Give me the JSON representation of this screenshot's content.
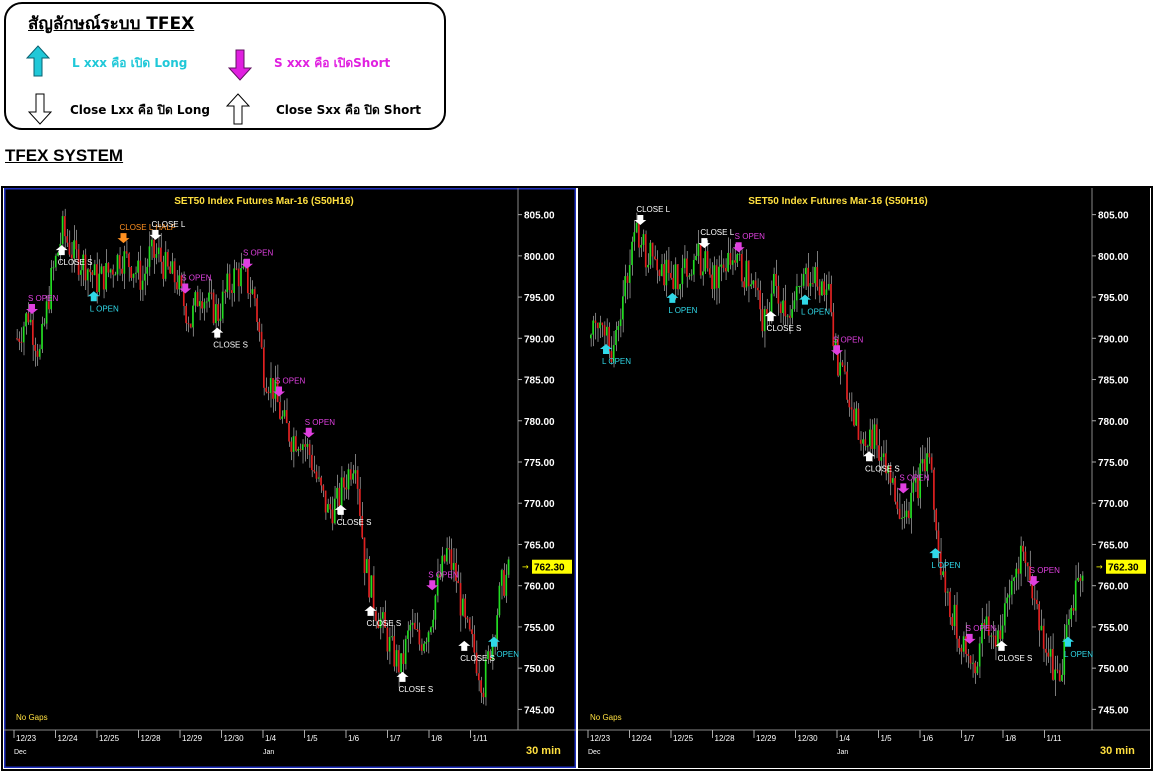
{
  "legend": {
    "title": "สัญลักษณ์ระบบ TFEX",
    "items": [
      {
        "icon": "up-arrow-cyan-icon",
        "label": "L xxx คือ เปิด Long",
        "color": "#20C8D8"
      },
      {
        "icon": "down-arrow-magenta-icon",
        "label": "S xxx คือ เปิดShort",
        "color": "#E020E0"
      },
      {
        "icon": "down-arrow-outline-icon",
        "label": "Close Lxx คือ ปิด Long",
        "color": "#000000"
      },
      {
        "icon": "up-arrow-outline-icon",
        "label": "Close Sxx คือ ปิด Short",
        "color": "#000000"
      }
    ]
  },
  "system_title": "TFEX SYSTEM",
  "chart_data": [
    {
      "type": "candlestick",
      "title": "SET50  Index  Futures  Mar-16   (S50H16)",
      "y_ticks": [
        "805.00",
        "800.00",
        "795.00",
        "790.00",
        "785.00",
        "780.00",
        "775.00",
        "770.00",
        "765.00",
        "760.00",
        "755.00",
        "750.00",
        "745.00"
      ],
      "ylim": [
        742.5,
        807.5
      ],
      "x_ticks": [
        "12/23",
        "12/24",
        "12/25",
        "12/28",
        "12/29",
        "12/30",
        "1/4",
        "1/5",
        "1/6",
        "1/7",
        "1/8",
        "1/11"
      ],
      "month_labels": [
        "Dec",
        "Jan"
      ],
      "last_price": "762.30",
      "interval": "30  min",
      "gap_note": "No Gaps",
      "signals": [
        {
          "label": "S  OPEN",
          "kind": "s-open"
        },
        {
          "label": "CLOSE  S",
          "kind": "close-s"
        },
        {
          "label": "L  OPEN",
          "kind": "l-open"
        },
        {
          "label": "CLOSE  L  HALF",
          "kind": "close-l-half"
        },
        {
          "label": "CLOSE  L",
          "kind": "close-l"
        },
        {
          "label": "S  OPEN",
          "kind": "s-open"
        },
        {
          "label": "CLOSE  S",
          "kind": "close-s"
        },
        {
          "label": "S  OPEN",
          "kind": "s-open"
        },
        {
          "label": "S  OPEN",
          "kind": "s-open"
        },
        {
          "label": "S  OPEN",
          "kind": "s-open"
        },
        {
          "label": "CLOSE  S",
          "kind": "close-s"
        },
        {
          "label": "CLOSE  S",
          "kind": "close-s"
        },
        {
          "label": "CLOSE  S",
          "kind": "close-s"
        },
        {
          "label": "S  OPEN",
          "kind": "s-open"
        },
        {
          "label": "CLOSE  S",
          "kind": "close-s"
        },
        {
          "label": "L  OPEN",
          "kind": "l-open"
        }
      ]
    },
    {
      "type": "candlestick",
      "title": "SET50  Index  Futures  Mar-16   (S50H16)",
      "y_ticks": [
        "805.00",
        "800.00",
        "795.00",
        "790.00",
        "785.00",
        "780.00",
        "775.00",
        "770.00",
        "765.00",
        "760.00",
        "755.00",
        "750.00",
        "745.00"
      ],
      "ylim": [
        742.5,
        807.5
      ],
      "x_ticks": [
        "12/23",
        "12/24",
        "12/25",
        "12/28",
        "12/29",
        "12/30",
        "1/4",
        "1/5",
        "1/6",
        "1/7",
        "1/8",
        "1/11"
      ],
      "month_labels": [
        "Dec",
        "Jan"
      ],
      "last_price": "762.30",
      "interval": "30  min",
      "gap_note": "No Gaps",
      "signals": [
        {
          "label": "L  OPEN",
          "kind": "l-open"
        },
        {
          "label": "CLOSE  L",
          "kind": "close-l"
        },
        {
          "label": "L  OPEN",
          "kind": "l-open"
        },
        {
          "label": "CLOSE  L",
          "kind": "close-l"
        },
        {
          "label": "S  OPEN",
          "kind": "s-open"
        },
        {
          "label": "CLOSE  S",
          "kind": "close-s"
        },
        {
          "label": "L  OPEN",
          "kind": "l-open"
        },
        {
          "label": "S  OPEN",
          "kind": "s-open"
        },
        {
          "label": "CLOSE  S",
          "kind": "close-s"
        },
        {
          "label": "S  OPEN",
          "kind": "s-open"
        },
        {
          "label": "L  OPEN",
          "kind": "l-open"
        },
        {
          "label": "S  OPEN",
          "kind": "s-open"
        },
        {
          "label": "CLOSE  S",
          "kind": "close-s"
        },
        {
          "label": "S  OPEN",
          "kind": "s-open"
        },
        {
          "label": "L  OPEN",
          "kind": "l-open"
        }
      ]
    }
  ],
  "colors": {
    "chart_bg": "#000000",
    "candle_up": "#22DD22",
    "candle_down": "#E02020",
    "title_text": "#FFE040",
    "axis_text": "#FFFFFF",
    "l_signal": "#30D8E8",
    "s_signal": "#E040E0",
    "close_signal": "#FFFFFF",
    "half_signal": "#FF9020",
    "price_tag": "#FFFF00",
    "left_border": "#2030C0"
  }
}
